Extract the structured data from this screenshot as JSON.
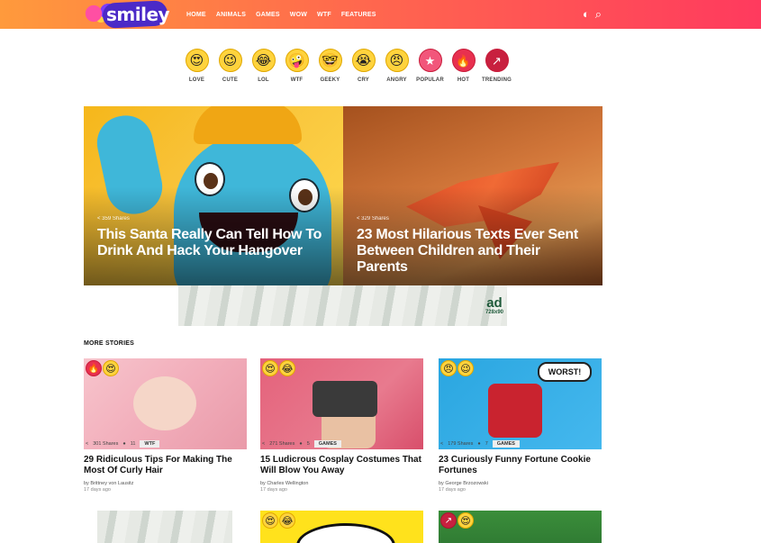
{
  "header": {
    "logo": "smiley",
    "nav": [
      "HOME",
      "ANIMALS",
      "GAMES",
      "WOW",
      "WTF",
      "FEATURES"
    ],
    "icons": [
      "dark-mode-icon",
      "search-icon"
    ]
  },
  "reactions": [
    {
      "label": "LOVE",
      "glyph": "😍"
    },
    {
      "label": "CUTE",
      "glyph": "😉"
    },
    {
      "label": "LOL",
      "glyph": "😂"
    },
    {
      "label": "WTF",
      "glyph": "🤪"
    },
    {
      "label": "GEEKY",
      "glyph": "🤓"
    },
    {
      "label": "CRY",
      "glyph": "😭"
    },
    {
      "label": "ANGRY",
      "glyph": "😠"
    },
    {
      "label": "POPULAR",
      "glyph": "★"
    },
    {
      "label": "HOT",
      "glyph": "🔥"
    },
    {
      "label": "TRENDING",
      "glyph": "↗"
    }
  ],
  "hero": [
    {
      "shares": "359 Shares",
      "title": "This Santa Really Can Tell How To Drink And Hack Your Hangover"
    },
    {
      "shares": "329 Shares",
      "title": "23 Most Hilarious Texts Ever Sent Between Children and Their Parents"
    }
  ],
  "ad": {
    "label": "ad",
    "size": "728x90"
  },
  "more_stories": {
    "title": "MORE STORIES",
    "cards": [
      {
        "shares": "301 Shares",
        "comments": "11",
        "tag": "WTF",
        "title": "29 Ridiculous Tips For Making The Most Of Curly Hair",
        "by": "by Brittney von Lausitz",
        "ago": "17 days ago"
      },
      {
        "shares": "271 Shares",
        "comments": "5",
        "tag": "GAMES",
        "title": "15 Ludicrous Cosplay Costumes That Will Blow You Away",
        "by": "by Charles Wellington",
        "ago": "17 days ago"
      },
      {
        "shares": "179 Shares",
        "comments": "7",
        "tag": "GAMES",
        "title": "23 Curiously Funny Fortune Cookie Fortunes",
        "by": "by George Brzozowski",
        "ago": "17 days ago"
      }
    ]
  },
  "colors": {
    "header_start": "#ff9a3c",
    "header_end": "#ff3a5e",
    "logo_bubble": "#4b2ac7",
    "hot_badge": "#e8304f"
  },
  "thumb_text": {
    "worst": "WORST!"
  }
}
